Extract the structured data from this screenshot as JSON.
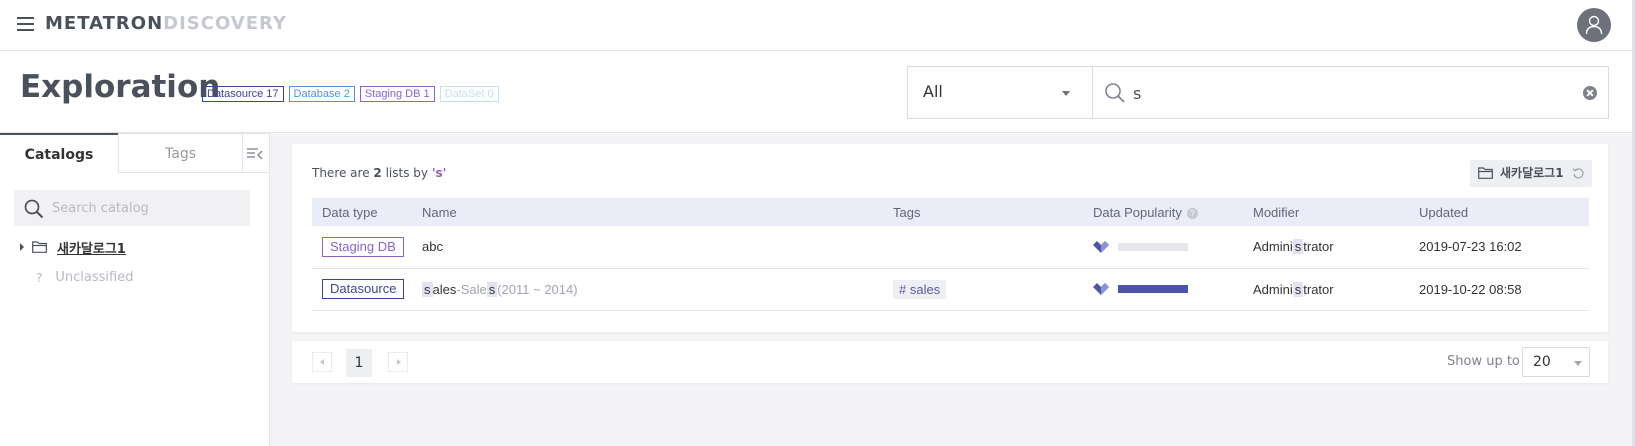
{
  "app": {
    "logo_primary": "METATRON",
    "logo_secondary": "DISCOVERY"
  },
  "header": {
    "title": "Exploration",
    "badges": {
      "datasource": "Datasource 17",
      "database": "Database 2",
      "staging": "Staging DB 1",
      "dataset": "DataSet 0"
    },
    "scope_value": "All",
    "search_value": "s"
  },
  "sidebar": {
    "tab_catalogs": "Catalogs",
    "tab_tags": "Tags",
    "search_placeholder": "Search catalog",
    "tree_item": "새카달로그1",
    "unclassified_icon": "?",
    "unclassified": "Unclassified"
  },
  "results": {
    "summary_prefix": "There are ",
    "summary_count": "2",
    "summary_mid": " lists by ",
    "summary_query": "'s'",
    "catalog_chip": "새카달로그1",
    "columns": {
      "type": "Data type",
      "name": "Name",
      "tags": "Tags",
      "popularity": "Data Popularity",
      "modifier": "Modifier",
      "updated": "Updated"
    },
    "rows": [
      {
        "type": "Staging DB",
        "name": "abc",
        "tag": "",
        "popularity": 0.0,
        "modifier_a": "Admini",
        "modifier_hl": "s",
        "modifier_b": "trator",
        "updated": "2019-07-23 16:02"
      },
      {
        "type": "Datasource",
        "name_hl1": "s",
        "name_a": "ales",
        "name_sep": "-Sale",
        "name_hl2": "s",
        "name_b": "(2011 ~ 2014)",
        "tag": "# sales",
        "popularity": 1.0,
        "modifier_a": "Admini",
        "modifier_hl": "s",
        "modifier_b": "trator",
        "updated": "2019-10-22 08:58"
      }
    ]
  },
  "pagination": {
    "current_page": "1",
    "show_up_label": "Show up to",
    "page_size": "20"
  },
  "colors": {
    "accent": "#4e54a6",
    "staging": "#8a63c9",
    "datasource": "#3e4496"
  }
}
